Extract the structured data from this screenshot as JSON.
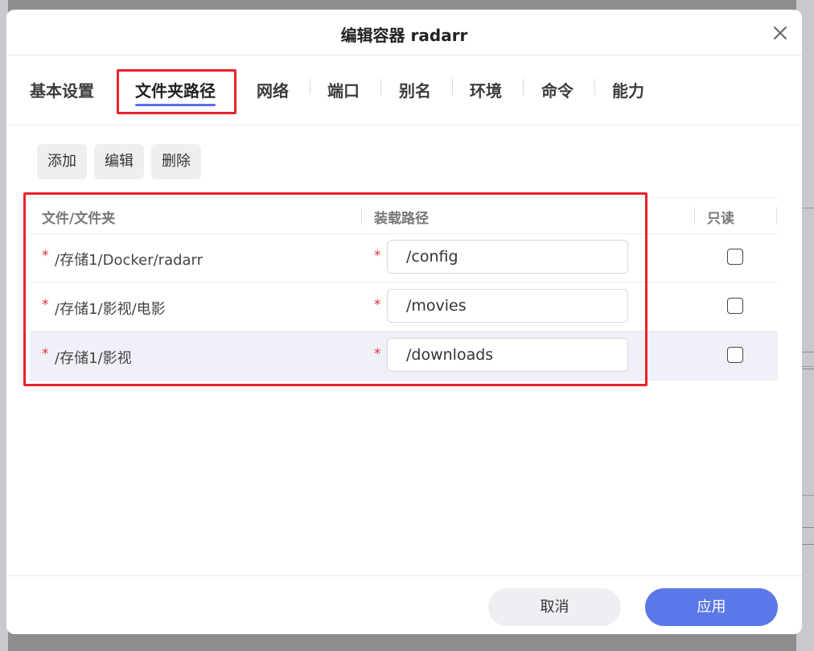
{
  "dialog": {
    "title": "编辑容器 radarr",
    "close_icon": "close-icon"
  },
  "tabs": [
    {
      "label": "基本设置",
      "active": false
    },
    {
      "label": "文件夹路径",
      "active": true
    },
    {
      "label": "网络",
      "active": false
    },
    {
      "label": "端口",
      "active": false
    },
    {
      "label": "别名",
      "active": false
    },
    {
      "label": "环境",
      "active": false
    },
    {
      "label": "命令",
      "active": false
    },
    {
      "label": "能力",
      "active": false
    }
  ],
  "toolbar": {
    "add_label": "添加",
    "edit_label": "编辑",
    "delete_label": "删除"
  },
  "table": {
    "headers": {
      "source": "文件/文件夹",
      "mount": "装载路径",
      "readonly": "只读"
    },
    "required_mark": "*",
    "rows": [
      {
        "source": "/存储1/Docker/radarr",
        "mount": "/config",
        "readonly": false
      },
      {
        "source": "/存储1/影视/电影",
        "mount": "/movies",
        "readonly": false
      },
      {
        "source": "/存储1/影视",
        "mount": "/downloads",
        "readonly": false
      }
    ]
  },
  "footer": {
    "cancel_label": "取消",
    "apply_label": "应用"
  },
  "colors": {
    "accent": "#5b6cf0",
    "apply_button": "#5b78e8",
    "highlight_box": "#e8232b",
    "required_star": "#e0303a"
  }
}
